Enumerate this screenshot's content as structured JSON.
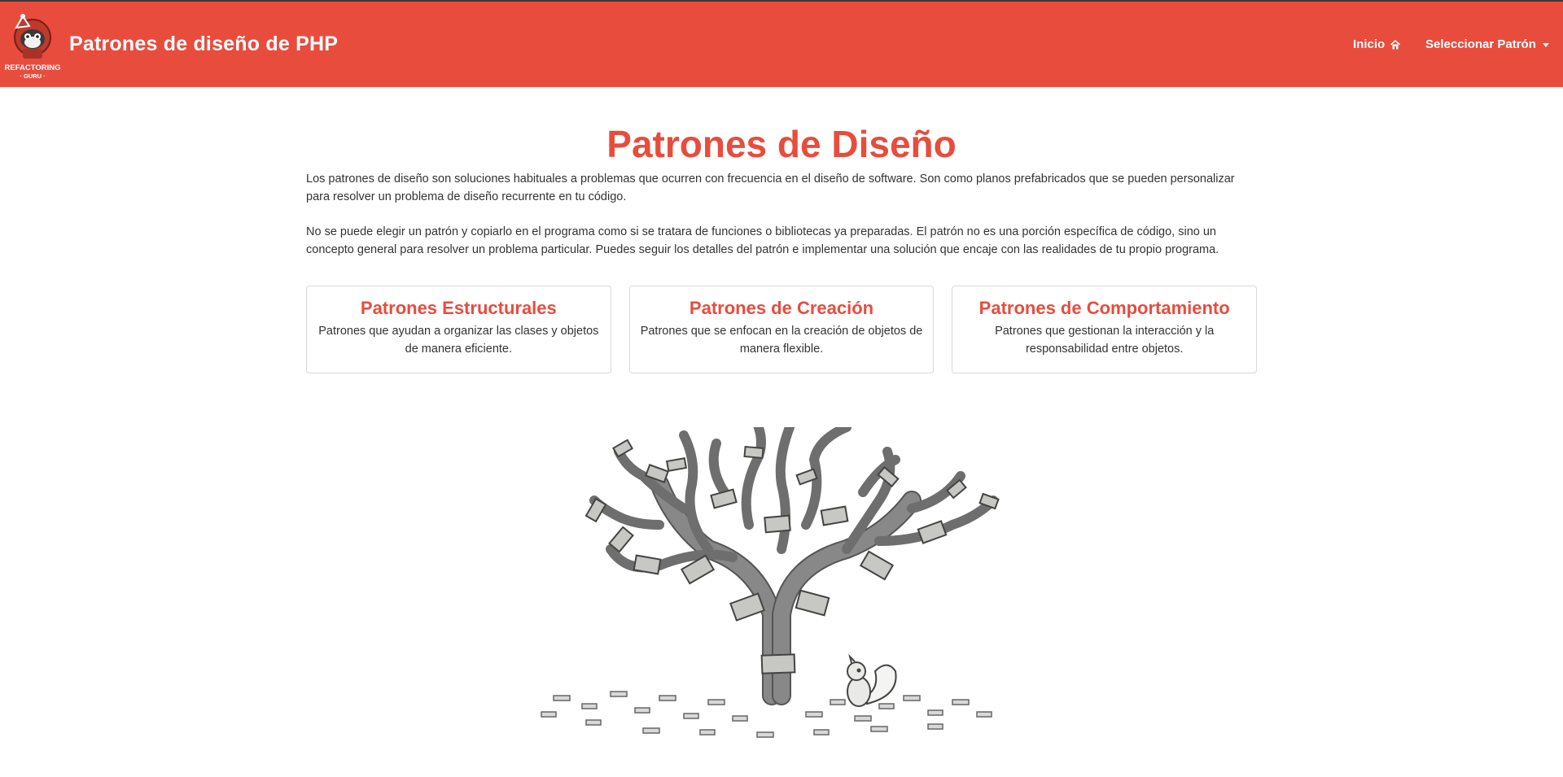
{
  "header": {
    "logo": {
      "icon": "refactoring-guru-raccoon-logo",
      "text_line1": "REFACTORING",
      "text_line2": "· GURU ·"
    },
    "title": "Patrones de diseño de PHP",
    "nav": {
      "home_label": "Inicio",
      "home_icon": "home-icon",
      "select_label": "Seleccionar Patrón",
      "select_icon": "caret-down-icon"
    },
    "colors": {
      "bar": "#e84c3d",
      "text": "#ffffff"
    }
  },
  "main": {
    "title": "Patrones de Diseño",
    "paragraphs": [
      "Los patrones de diseño son soluciones habituales a problemas que ocurren con frecuencia en el diseño de software. Son como planos prefabricados que se pueden personalizar para resolver un problema de diseño recurrente en tu código.",
      "No se puede elegir un patrón y copiarlo en el programa como si se tratara de funciones o bibliotecas ya preparadas. El patrón no es una porción específica de código, sino un concepto general para resolver un problema particular. Puedes seguir los detalles del patrón e implementar una solución que encaje con las realidades de tu propio programa."
    ],
    "cards": [
      {
        "title": "Patrones Estructurales",
        "description": "Patrones que ayudan a organizar las clases y objetos de manera eficiente."
      },
      {
        "title": "Patrones de Creación",
        "description": "Patrones que se enfocan en la creación de objetos de manera flexible."
      },
      {
        "title": "Patrones de Comportamiento",
        "description": "Patrones que gestionan la interacción y la responsabilidad entre objetos."
      }
    ],
    "illustration": {
      "icon": "design-patterns-tree-illustration"
    },
    "accent_color": "#e84c3d"
  }
}
